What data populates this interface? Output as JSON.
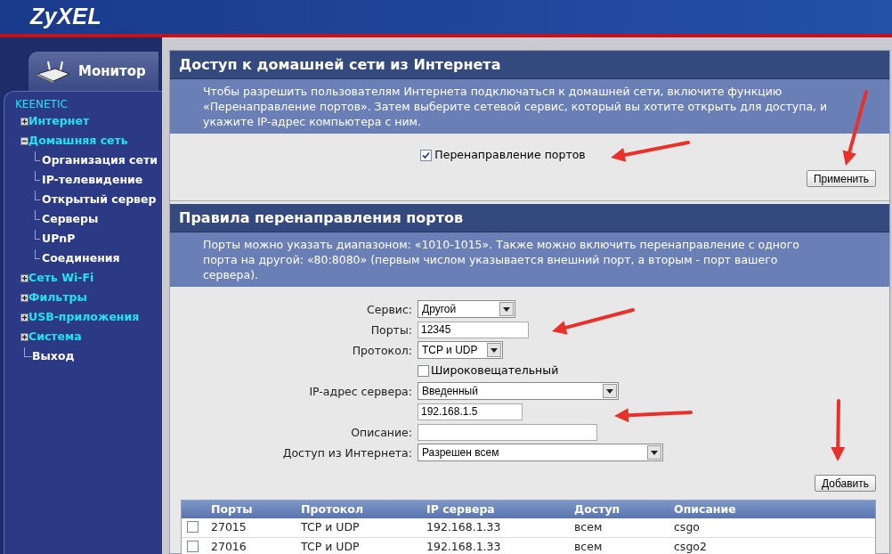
{
  "header": {
    "logo": "ZyXEL"
  },
  "sidebar": {
    "tab": "Монитор",
    "device": "KEENETIC",
    "items": [
      {
        "label": "Интернет",
        "kind": "group",
        "expanded": false
      },
      {
        "label": "Домашняя сеть",
        "kind": "group",
        "expanded": true,
        "children": [
          {
            "label": "Организация сети"
          },
          {
            "label": "IP-телевидение"
          },
          {
            "label": "Открытый сервер"
          },
          {
            "label": "Серверы"
          },
          {
            "label": "UPnP"
          },
          {
            "label": "Соединения"
          }
        ]
      },
      {
        "label": "Сеть Wi-Fi",
        "kind": "group",
        "expanded": false
      },
      {
        "label": "Фильтры",
        "kind": "group",
        "expanded": false
      },
      {
        "label": "USB-приложения",
        "kind": "group",
        "expanded": false
      },
      {
        "label": "Система",
        "kind": "group",
        "expanded": false
      },
      {
        "label": "Выход",
        "kind": "leaf"
      }
    ]
  },
  "access_section": {
    "title": "Доступ к домашней сети из Интернета",
    "description": "Чтобы разрешить пользователям Интернета подключаться к домашней сети, включите функцию «Перенаправление портов». Затем выберите сетевой сервис, который вы хотите открыть для доступа, и укажите IP-адрес компьютера с ним.",
    "checkbox": {
      "label": "Перенаправление портов",
      "checked": true
    },
    "button": "Применить"
  },
  "rules_section": {
    "title": "Правила перенаправления портов",
    "description": "Порты можно указать диапазоном: «1010-1015». Также можно включить перенаправление с одного порта на другой: «80:8080» (первым числом указывается внешний порт, а вторым - порт вашего сервера).",
    "fields": [
      {
        "kind": "select",
        "label": "Сервис:",
        "value": "Другой"
      },
      {
        "kind": "input",
        "label": "Порты:",
        "value": "12345"
      },
      {
        "kind": "select",
        "label": "Протокол:",
        "value": "TCP и UDP"
      },
      {
        "kind": "checkbox",
        "label": "Широковещательный",
        "checked": false
      },
      {
        "kind": "select",
        "label": "IP-адрес сервера:",
        "value": "Введенный"
      },
      {
        "kind": "input",
        "value": "192.168.1.5"
      },
      {
        "kind": "input",
        "label": "Описание:"
      },
      {
        "kind": "select",
        "label": "Доступ из Интернета:",
        "value": "Разрешен всем"
      }
    ],
    "button": "Добавить",
    "table": {
      "columns": [
        "Порты",
        "Протокол",
        "IP сервера",
        "Доступ",
        "Описание"
      ],
      "rows": [
        {
          "checked": false,
          "cells": [
            "27015",
            "TCP и UDP",
            "192.168.1.33",
            "всем",
            "csgo"
          ]
        },
        {
          "checked": false,
          "cells": [
            "27016",
            "TCP и UDP",
            "192.168.1.33",
            "всем",
            "csgo2"
          ]
        }
      ]
    }
  }
}
